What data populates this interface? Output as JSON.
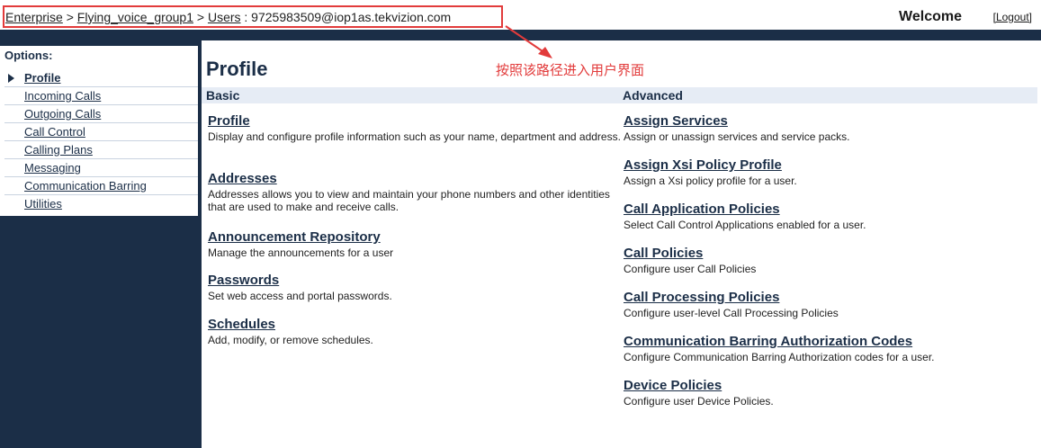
{
  "header": {
    "breadcrumb": {
      "enterprise": "Enterprise",
      "sep1": " > ",
      "group": "Flying_voice_group1",
      "sep2": " > ",
      "users": "Users",
      "suffix": " : 9725983509@iop1as.tekvizion.com"
    },
    "welcome": "Welcome",
    "logout": "[Logout]"
  },
  "annotation": {
    "note": "按照该路径进入用户界面",
    "color": "#e23b3b"
  },
  "sidebar": {
    "title": "Options:",
    "items": [
      {
        "label": "Profile",
        "active": true
      },
      {
        "label": "Incoming Calls"
      },
      {
        "label": "Outgoing Calls"
      },
      {
        "label": "Call Control"
      },
      {
        "label": "Calling Plans"
      },
      {
        "label": "Messaging"
      },
      {
        "label": "Communication Barring"
      },
      {
        "label": "Utilities"
      }
    ]
  },
  "main": {
    "title": "Profile",
    "basic": {
      "heading": "Basic",
      "items": [
        {
          "label": "Profile",
          "desc": "Display and configure profile information such as your name, department and address."
        },
        {
          "label": "Addresses",
          "desc": "Addresses allows you to view and maintain your phone numbers and other identities that are used to make and receive calls."
        },
        {
          "label": "Announcement Repository",
          "desc": "Manage the announcements for a user"
        },
        {
          "label": "Passwords",
          "desc": "Set web access and portal passwords."
        },
        {
          "label": "Schedules",
          "desc": "Add, modify, or remove schedules."
        }
      ]
    },
    "advanced": {
      "heading": "Advanced",
      "items": [
        {
          "label": "Assign Services",
          "desc": "Assign or unassign services and service packs."
        },
        {
          "label": "Assign Xsi Policy Profile",
          "desc": "Assign a Xsi policy profile for a user."
        },
        {
          "label": "Call Application Policies",
          "desc": "Select Call Control Applications enabled for a user."
        },
        {
          "label": "Call Policies",
          "desc": "Configure user Call Policies"
        },
        {
          "label": "Call Processing Policies",
          "desc": "Configure user-level Call Processing Policies"
        },
        {
          "label": "Communication Barring Authorization Codes",
          "desc": "Configure Communication Barring Authorization codes for a user."
        },
        {
          "label": "Device Policies",
          "desc": "Configure user Device Policies."
        }
      ]
    }
  },
  "colors": {
    "navy": "#1b2e47",
    "header_band": "#e6ecf5"
  }
}
